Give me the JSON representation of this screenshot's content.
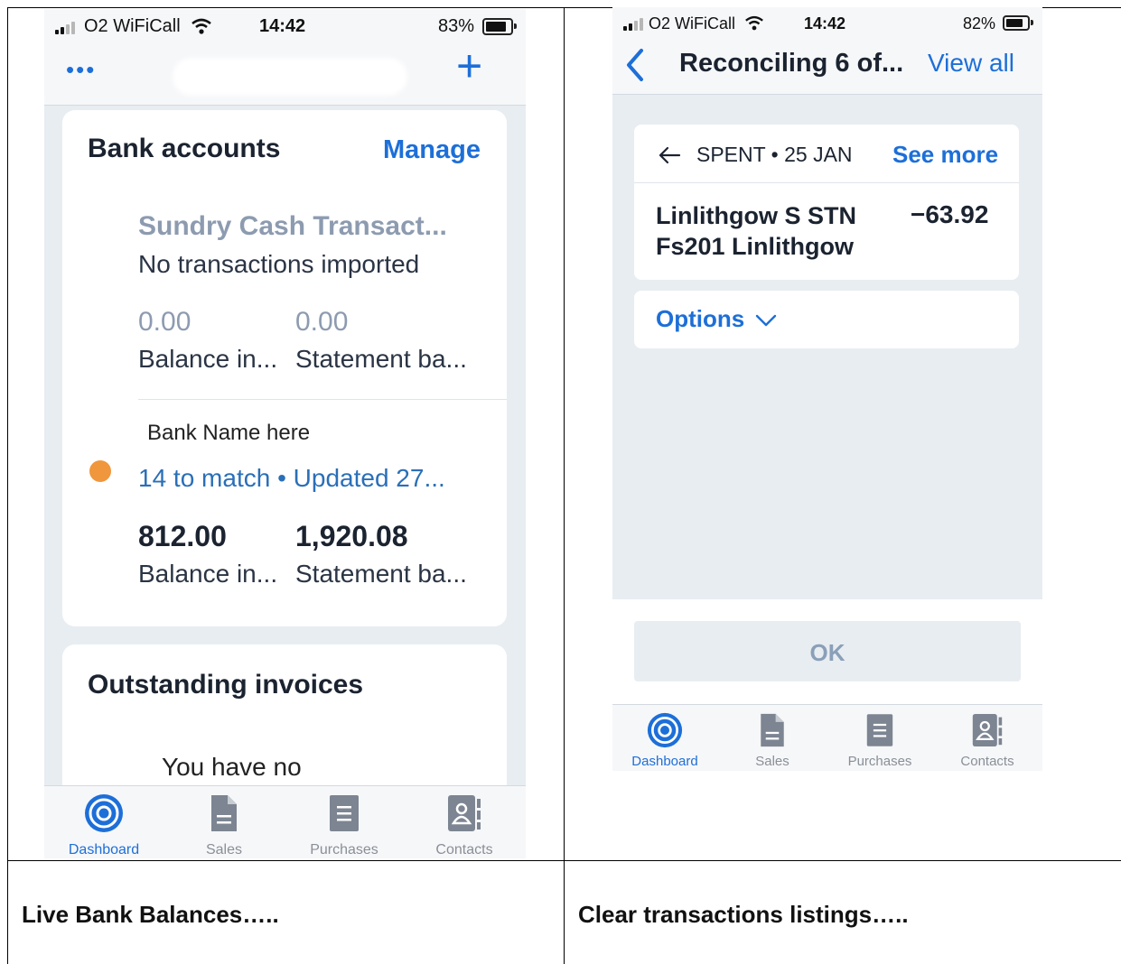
{
  "left_screen": {
    "status": {
      "carrier": "O2 WiFiCall",
      "time": "14:42",
      "battery": "83%",
      "battery_level": 0.83
    },
    "header": {
      "more_label": "•••",
      "add_label": "+"
    },
    "bank_card": {
      "title": "Bank accounts",
      "manage_label": "Manage",
      "accounts": [
        {
          "name": "Sundry Cash Transact...",
          "status": "No transactions imported",
          "balance_value": "0.00",
          "balance_label": "Balance in...",
          "statement_value": "0.00",
          "statement_label": "Statement ba..."
        },
        {
          "name": "Bank Name here",
          "status": "14 to match • Updated 27...",
          "balance_value": "812.00",
          "balance_label": "Balance in...",
          "statement_value": "1,920.08",
          "statement_label": "Statement ba...",
          "dot_color": "#f0963c"
        }
      ]
    },
    "invoices_card": {
      "title": "Outstanding invoices",
      "message": "You have no"
    },
    "tabbar": [
      {
        "label": "Dashboard",
        "icon": "dashboard-icon",
        "active": true
      },
      {
        "label": "Sales",
        "icon": "sales-icon",
        "active": false
      },
      {
        "label": "Purchases",
        "icon": "purchases-icon",
        "active": false
      },
      {
        "label": "Contacts",
        "icon": "contacts-icon",
        "active": false
      }
    ]
  },
  "right_screen": {
    "status": {
      "carrier": "O2 WiFiCall",
      "time": "14:42",
      "battery": "82%",
      "battery_level": 0.82
    },
    "nav": {
      "title": "Reconciling 6 of...",
      "view_all_label": "View all"
    },
    "transaction": {
      "direction": "SPENT • 25 JAN",
      "see_more_label": "See more",
      "payee_line1": "Linlithgow S STN",
      "payee_line2": "Fs201 Linlithgow",
      "amount": "−63.92"
    },
    "options_label": "Options",
    "ok_label": "OK",
    "tabbar": [
      {
        "label": "Dashboard",
        "icon": "dashboard-icon",
        "active": true
      },
      {
        "label": "Sales",
        "icon": "sales-icon",
        "active": false
      },
      {
        "label": "Purchases",
        "icon": "purchases-icon",
        "active": false
      },
      {
        "label": "Contacts",
        "icon": "contacts-icon",
        "active": false
      }
    ]
  },
  "captions": {
    "left": "Live Bank Balances…..",
    "right": "Clear transactions listings….."
  },
  "colors": {
    "accent": "#1d6fd8",
    "screen_bg": "#e8edf2",
    "muted_text": "#8d9bb0",
    "dot": "#f0963c"
  }
}
